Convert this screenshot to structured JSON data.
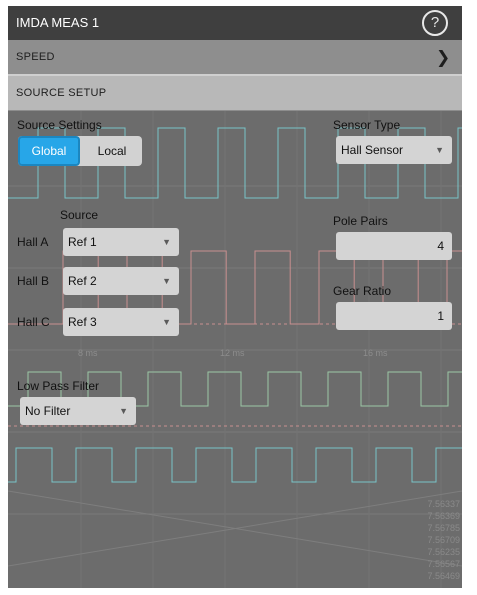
{
  "window": {
    "title": "IMDA MEAS 1",
    "help_icon": "?"
  },
  "rows": {
    "speed_label": "SPEED",
    "speed_chevron": "❯",
    "source_setup_label": "SOURCE SETUP"
  },
  "source_settings": {
    "label": "Source Settings",
    "options": [
      "Global",
      "Local"
    ],
    "selected": "Global"
  },
  "sensor_type": {
    "label": "Sensor Type",
    "value": "Hall Sensor"
  },
  "source": {
    "header": "Source",
    "halls": [
      {
        "label": "Hall A",
        "value": "Ref 1"
      },
      {
        "label": "Hall B",
        "value": "Ref 2"
      },
      {
        "label": "Hall C",
        "value": "Ref 3"
      }
    ]
  },
  "pole_pairs": {
    "label": "Pole Pairs",
    "value": "4"
  },
  "gear_ratio": {
    "label": "Gear Ratio",
    "value": "1"
  },
  "low_pass_filter": {
    "label": "Low Pass Filter",
    "value": "No Filter"
  },
  "background": {
    "time_ticks": [
      "8 ms",
      "12 ms",
      "16 ms"
    ],
    "readouts": [
      "7.56337",
      "7.56369",
      "7.56785",
      "7.56709",
      "7.56235",
      "7.56567",
      "7.56469"
    ]
  },
  "colors": {
    "accent": "#27a6e8",
    "panel": "#6c6c6c",
    "trace_cyan": "#79c4c8",
    "trace_red": "#c98f8f"
  },
  "icons": {
    "dropdown": "chevron-down-icon",
    "help": "help-icon"
  }
}
